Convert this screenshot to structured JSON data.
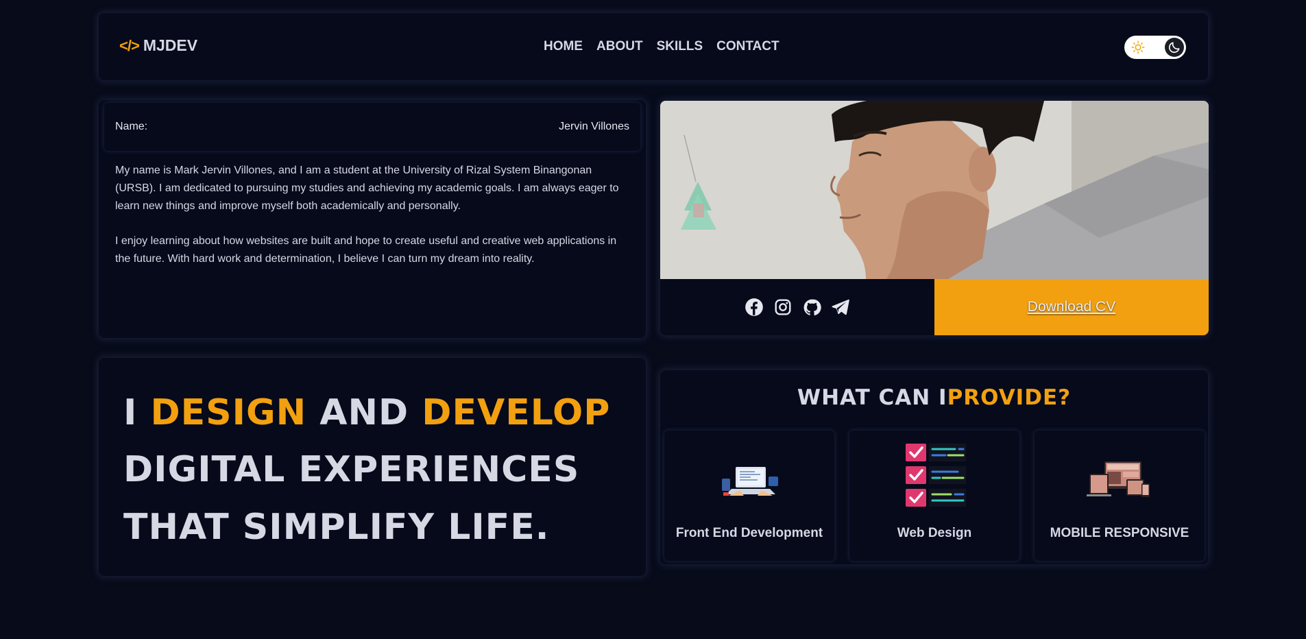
{
  "header": {
    "logo_mark": "</>",
    "logo_text": "MJDEV",
    "nav": [
      "HOME",
      "ABOUT",
      "SKILLS",
      "CONTACT"
    ],
    "theme_toggle": {
      "light_icon": "sun-icon",
      "dark_icon": "moon-icon",
      "active": "dark"
    }
  },
  "about": {
    "name_label": "Name:",
    "name_value": "Jervin Villones",
    "paragraphs": [
      "My name is Mark Jervin Villones, and I am a student at the University of Rizal System Binangonan (URSB). I am dedicated to pursuing my studies and achieving my academic goals. I am always eager to learn new things and improve myself both academically and personally.",
      "I enjoy learning about how websites are built and hope to create useful and creative web applications in the future. With hard work and determination, I believe I can turn my dream into reality."
    ]
  },
  "profile": {
    "social_icons": [
      "facebook-icon",
      "instagram-icon",
      "github-icon",
      "telegram-icon"
    ],
    "cv_label": "Download CV"
  },
  "hero": {
    "line1": {
      "w1": "I ",
      "w2": "DESIGN",
      "w3": " AND ",
      "w4": "DEVELOP"
    },
    "line2": "DIGITAL EXPERIENCES",
    "line3": "THAT SIMPLIFY LIFE."
  },
  "services": {
    "title_part1": "WHAT CAN I",
    "title_part2": "PROVIDE?",
    "items": [
      {
        "label": "Front End Development",
        "icon": "laptop-coding-illustration"
      },
      {
        "label": "Web Design",
        "icon": "checklist-illustration"
      },
      {
        "label": "MOBILE RESPONSIVE",
        "icon": "responsive-devices-illustration"
      }
    ]
  },
  "colors": {
    "background": "#070b1a",
    "accent": "#f2a010",
    "text": "#d6d8e4"
  }
}
